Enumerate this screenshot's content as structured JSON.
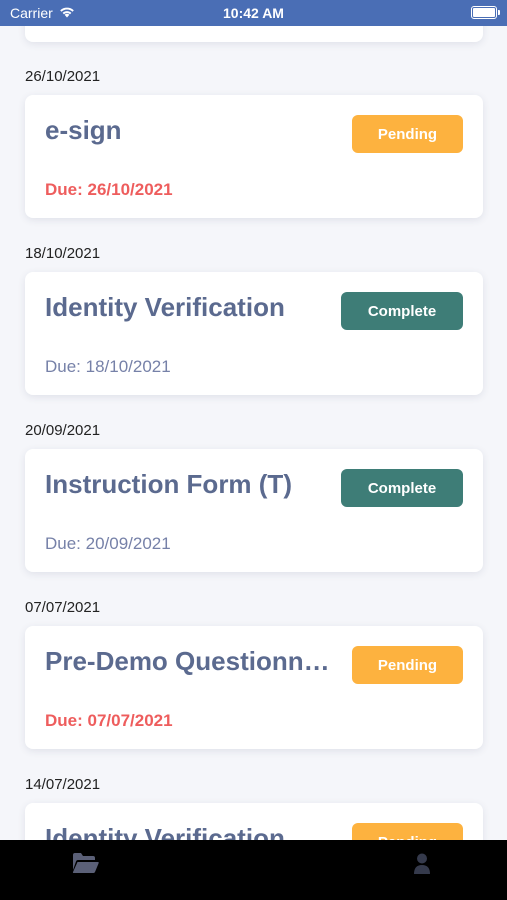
{
  "status_bar": {
    "carrier": "Carrier",
    "time": "10:42 AM"
  },
  "sections": [
    {
      "date": "26/10/2021",
      "title": "e-sign",
      "status": "Pending",
      "due": "Due: 26/10/2021"
    },
    {
      "date": "18/10/2021",
      "title": "Identity Verification",
      "status": "Complete",
      "due": "Due: 18/10/2021"
    },
    {
      "date": "20/09/2021",
      "title": "Instruction Form (T)",
      "status": "Complete",
      "due": "Due: 20/09/2021"
    },
    {
      "date": "07/07/2021",
      "title": "Pre-Demo Questionnaire",
      "status": "Pending",
      "due": "Due: 07/07/2021"
    },
    {
      "date": "14/07/2021",
      "title": "Identity Verification",
      "status": "Pending",
      "due": ""
    }
  ],
  "colors": {
    "pending": "#fdb23f",
    "complete": "#3e7d77",
    "overdue": "#ee5d5d",
    "status_bar": "#4a6eb5"
  },
  "tab_bar": {
    "tabs": [
      {
        "icon": "folder-open-icon"
      },
      {
        "icon": "user-icon"
      }
    ]
  }
}
